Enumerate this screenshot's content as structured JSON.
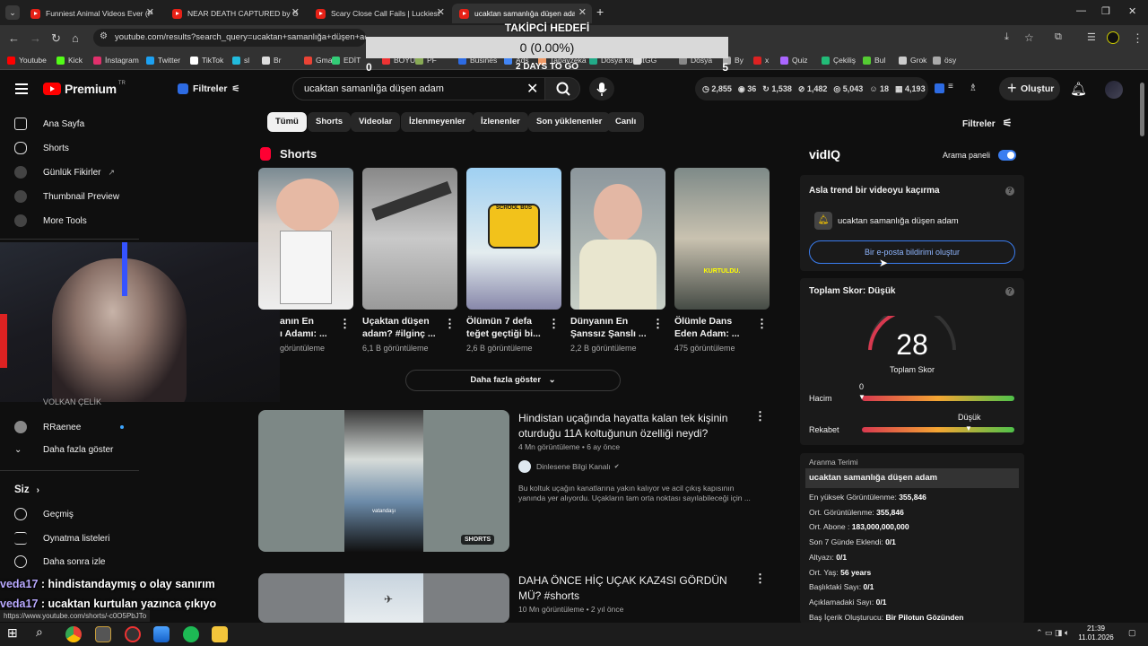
{
  "tabs": [
    {
      "title": "Funniest Animal Videos Ever (P",
      "active": false
    },
    {
      "title": "NEAR DEATH CAPTURED by G",
      "active": false
    },
    {
      "title": "Scary Close Call Fails | Luckiest",
      "active": false
    },
    {
      "title": "ucaktan samanlığa düşen adam",
      "active": true
    }
  ],
  "address": {
    "url": "youtube.com/results?search_query=ucaktan+samanlığa+düşen+adam"
  },
  "bookmarks": [
    "Youtube",
    "Kick",
    "İnstagram",
    "Twitter",
    "TikTok",
    "sl",
    "Br",
    "Gmail",
    "EDİT",
    "BOYUT",
    "PF",
    "Busines",
    "Ads",
    "Tapayzeka",
    "Dosya küçült",
    "GG",
    "Dosya",
    "By",
    "x",
    "Quiz",
    "Çekiliş",
    "Bul",
    "Grok",
    "ösy"
  ],
  "overlay": {
    "title": "TAKİPCİ HEDEFİ",
    "value": "0 (0.00%)",
    "left": "0",
    "right": "5",
    "days": "2 DAYS TO GO"
  },
  "header": {
    "brand": "Premium",
    "region": "TR",
    "filters": "Filtreler",
    "query": "ucaktan samanlığa düşen adam",
    "create": "Oluştur",
    "stats": [
      "2,855",
      "36",
      "1,538",
      "1,482",
      "5,043",
      "18",
      "4,193"
    ]
  },
  "sidebar": {
    "items": [
      "Ana Sayfa",
      "Shorts",
      "Günlük Fikirler",
      "Thumbnail Preview",
      "More Tools"
    ],
    "subs": [
      "VOLKAN ÇELİK",
      "RRaenee"
    ],
    "more": "Daha fazla göster",
    "you": "Siz",
    "you_items": [
      "Geçmiş",
      "Oynatma listeleri",
      "Daha sonra izle"
    ]
  },
  "chat": [
    {
      "user": "veda17",
      "msg": "hindistandaymış o olay sanırım"
    },
    {
      "user": "veda17",
      "msg": "ucaktan kurtulan yazınca çıkıyo"
    }
  ],
  "chips": [
    "Tümü",
    "Shorts",
    "Videolar",
    "İzlenmeyenler",
    "İzlenenler",
    "Son yüklenenler",
    "Canlı"
  ],
  "filters_right": "Filtreler",
  "shorts": {
    "heading": "Shorts",
    "more": "Daha fazla göster",
    "items": [
      {
        "title": "anın En",
        "title2": "ı Adamı: ...",
        "views": "görüntüleme",
        "thumb_text": ""
      },
      {
        "title": "Uçaktan düşen",
        "title2": "adam? #ilginç ...",
        "views": "6,1 B görüntüleme",
        "thumb_text": ""
      },
      {
        "title": "Ölümün 7 defa",
        "title2": "teğet geçtiği bi...",
        "views": "2,6 B görüntüleme",
        "thumb_text": "SCHOOL BUS"
      },
      {
        "title": "Dünyanın En",
        "title2": "Şanssız Şanslı ...",
        "views": "2,2 B görüntüleme",
        "thumb_text": ""
      },
      {
        "title": "Ölümle Dans",
        "title2": "Eden Adam: ...",
        "views": "475 görüntüleme",
        "thumb_text": "KURTULDU."
      }
    ]
  },
  "videos": [
    {
      "title": "Hindistan uçağında hayatta kalan tek kişinin oturduğu 11A koltuğunun özelliği neydi?",
      "meta": "4 Mn görüntüleme • 6 ay önce",
      "channel": "Dinlesene Bilgi Kanalı",
      "desc": "Bu koltuk uçağın kanatlarına yakın kalıyor ve acil çıkış kapısının yanında yer alıyordu. Uçakların tam orta noktası sayılabileceği için ...",
      "badge": "SHORTS",
      "thumb_text": "vatandaşı"
    },
    {
      "title": "DAHA ÖNCE HİÇ UÇAK KAZ4SI GÖRDÜN MÜ? #shorts",
      "meta": "10 Mn görüntüleme • 2 yıl önce"
    }
  ],
  "vidiq": {
    "brand": "vidIQ",
    "toggle": "Arama paneli",
    "trend_title": "Asla trend bir videoyu kaçırma",
    "trend_query": "ucaktan samanlığa düşen adam",
    "notify": "Bir e-posta bildirimi oluştur",
    "score_title": "Toplam Skor: Düşük",
    "score": "28",
    "score_label": "Toplam Skor",
    "volume": "Hacim",
    "volume_val": "0",
    "competition": "Rekabet",
    "competition_val": "Düşük",
    "term_title": "Aranma Terimi",
    "term": "ucaktan samanlığa düşen adam",
    "rows": [
      {
        "k": "En yüksek Görüntülenme:",
        "v": "355,846"
      },
      {
        "k": "Ort. Görüntülenme:",
        "v": "355,846"
      },
      {
        "k": "Ort. Abone :",
        "v": "183,000,000,000"
      },
      {
        "k": "Son 7 Günde Eklendi:",
        "v": "0/1"
      },
      {
        "k": "Altyazı:",
        "v": "0/1"
      },
      {
        "k": "Ort. Yaş:",
        "v": "56 years"
      },
      {
        "k": "Başlıktaki Sayı:",
        "v": "0/1"
      },
      {
        "k": "Açıklamadaki Sayı:",
        "v": "0/1"
      },
      {
        "k": "Baş İçerik Oluşturucu:",
        "v": "Bir Pilotun Gözünden"
      }
    ]
  },
  "status_url": "https://www.youtube.com/shorts/-c0O5PbJTo",
  "clock": {
    "time": "21:39",
    "date": "11.01.2026"
  }
}
